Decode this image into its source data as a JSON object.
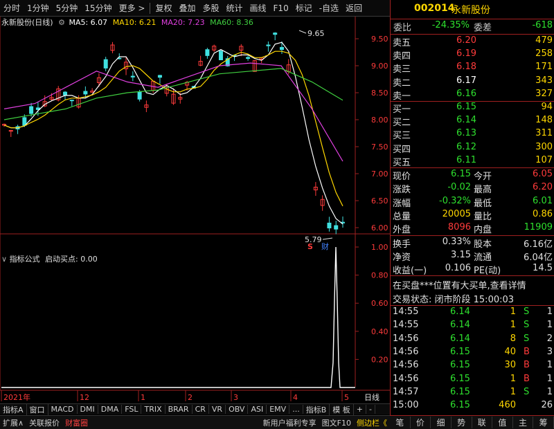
{
  "toolbar": {
    "left_items": [
      "分时",
      "1分钟",
      "5分钟",
      "15分钟",
      "更多 >"
    ],
    "right_items": [
      "复权",
      "叠加",
      "多股",
      "统计",
      "画线",
      "F10",
      "标记",
      "-自选",
      "返回"
    ]
  },
  "chart": {
    "stock_label": "永新股份(日线)",
    "ma5_label": "MA5: 6.07",
    "ma10_label": "MA10: 6.21",
    "ma20_label": "MA20: 7.23",
    "ma60_label": "MA60: 8.36",
    "max_label": "9.65",
    "min_label": "5.79",
    "s_marker": "S",
    "cai_marker": "财",
    "ma_colors": {
      "ma5": "#ffffff",
      "ma10": "#ffd700",
      "ma20": "#e040e0",
      "ma60": "#40d040"
    },
    "indicator_label": "指标公式",
    "indicator_value": "启动买点: 0.00",
    "x_axis": [
      "2021年",
      "12",
      "1",
      "2",
      "3",
      "4",
      "5"
    ],
    "x_axis_right": "日线",
    "price_ticks": [
      "9.50",
      "9.00",
      "8.50",
      "8.00",
      "7.50",
      "7.00",
      "6.50",
      "6.00"
    ],
    "ind_ticks": [
      "1.00",
      "0.80",
      "0.60",
      "0.40",
      "0.20"
    ]
  },
  "chart_data": {
    "type": "line",
    "title": "",
    "ylim": [
      5.7,
      9.8
    ],
    "series": [
      {
        "name": "MA20",
        "values": [
          8.2,
          8.3,
          8.6,
          8.9,
          8.7,
          8.6,
          8.8,
          9.0,
          9.05,
          9.0,
          8.2,
          7.23
        ]
      },
      {
        "name": "MA60",
        "values": [
          8.0,
          8.1,
          8.2,
          8.4,
          8.5,
          8.55,
          8.7,
          8.85,
          8.9,
          8.95,
          8.7,
          8.36
        ]
      }
    ]
  },
  "indicator_bar": [
    "指标A",
    "窗口",
    "MACD",
    "DMI",
    "DMA",
    "FSL",
    "TRIX",
    "BRAR",
    "CR",
    "VR",
    "OBV",
    "ASI",
    "EMV",
    "...",
    "指标B",
    "模 板",
    "+",
    "-"
  ],
  "ext_bar": {
    "expand": "扩展∧",
    "related": "关联报价",
    "wealth": "财富圈",
    "promo": "新用户福利专享",
    "f10": "图文F10",
    "side": "侧边栏《"
  },
  "quote": {
    "code": "002014",
    "name": "永新股份",
    "webi_label": "委比",
    "webi": "-24.35%",
    "wecha_label": "委差",
    "wecha": "-618",
    "sell": [
      {
        "label": "卖五",
        "price": "6.20",
        "vol": "479"
      },
      {
        "label": "卖四",
        "price": "6.19",
        "vol": "258"
      },
      {
        "label": "卖三",
        "price": "6.18",
        "vol": "171"
      },
      {
        "label": "卖二",
        "price": "6.17",
        "vol": "343"
      },
      {
        "label": "卖一",
        "price": "6.16",
        "vol": "327"
      }
    ],
    "buy": [
      {
        "label": "买一",
        "price": "6.15",
        "vol": "94"
      },
      {
        "label": "买二",
        "price": "6.14",
        "vol": "148"
      },
      {
        "label": "买三",
        "price": "6.13",
        "vol": "311"
      },
      {
        "label": "买四",
        "price": "6.12",
        "vol": "300"
      },
      {
        "label": "买五",
        "price": "6.11",
        "vol": "107"
      }
    ],
    "stats": [
      {
        "l1": "现价",
        "v1": "6.15",
        "l2": "今开",
        "v2": "6.05"
      },
      {
        "l1": "涨跌",
        "v1": "-0.02",
        "l2": "最高",
        "v2": "6.20"
      },
      {
        "l1": "涨幅",
        "v1": "-0.32%",
        "l2": "最低",
        "v2": "6.01"
      },
      {
        "l1": "总量",
        "v1": "20005",
        "l2": "量比",
        "v2": "0.86"
      },
      {
        "l1": "外盘",
        "v1": "8096",
        "l2": "内盘",
        "v2": "11909"
      }
    ],
    "fund": [
      {
        "l1": "换手",
        "v1": "0.33%",
        "l2": "股本",
        "v2": "6.16亿"
      },
      {
        "l1": "净资",
        "v1": "3.15",
        "l2": "流通",
        "v2": "6.04亿"
      },
      {
        "l1": "收益(一)",
        "v1": "0.106",
        "l2": "PE(动)",
        "v2": "14.5"
      }
    ],
    "notice": "在买盘***位置有大买单,查看详情",
    "status": "交易状态: 闭市阶段 15:00:03",
    "ticks": [
      {
        "t": "14:55",
        "p": "6.14",
        "v": "1",
        "bs": "S",
        "n": "1"
      },
      {
        "t": "14:55",
        "p": "6.14",
        "v": "1",
        "bs": "S",
        "n": "1"
      },
      {
        "t": "14:56",
        "p": "6.14",
        "v": "8",
        "bs": "S",
        "n": "2"
      },
      {
        "t": "14:56",
        "p": "6.15",
        "v": "40",
        "bs": "B",
        "n": "3"
      },
      {
        "t": "14:56",
        "p": "6.15",
        "v": "30",
        "bs": "B",
        "n": "1"
      },
      {
        "t": "14:56",
        "p": "6.15",
        "v": "1",
        "bs": "B",
        "n": "1"
      },
      {
        "t": "14:57",
        "p": "6.15",
        "v": "1",
        "bs": "S",
        "n": "1"
      },
      {
        "t": "15:00",
        "p": "6.15",
        "v": "460",
        "bs": "",
        "n": "26"
      }
    ],
    "tabs": [
      "笔",
      "价",
      "细",
      "势",
      "联",
      "值",
      "主",
      "筹"
    ]
  }
}
